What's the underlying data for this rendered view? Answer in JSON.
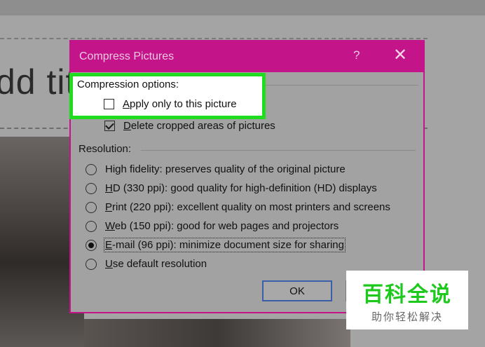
{
  "background": {
    "slide_title_fragment": "dd tit"
  },
  "dialog": {
    "title": "Compress Pictures",
    "help_label": "?",
    "close_label": "✕",
    "compression": {
      "heading": "Compression options:",
      "apply_only_label": "Apply only to this picture",
      "apply_only_checked": false,
      "delete_cropped_label": "Delete cropped areas of pictures",
      "delete_cropped_checked": true
    },
    "resolution": {
      "heading": "Resolution:",
      "options": [
        {
          "label": "High fidelity: preserves quality of the original picture",
          "selected": false
        },
        {
          "label": "HD (330 ppi): good quality for high-definition (HD) displays",
          "selected": false
        },
        {
          "label": "Print (220 ppi): excellent quality on most printers and screens",
          "selected": false
        },
        {
          "label": "Web (150 ppi): good for web pages and projectors",
          "selected": false
        },
        {
          "label": "E-mail (96 ppi): minimize document size for sharing",
          "selected": true
        },
        {
          "label": "Use default resolution",
          "selected": false
        }
      ]
    },
    "ok_label": "OK"
  },
  "watermark": {
    "main": "百科全说",
    "sub": "助你轻松解决"
  },
  "colors": {
    "titlebar": "#c4148a",
    "highlight_border": "#1fdc1f",
    "watermark_green": "#1ec91e"
  }
}
